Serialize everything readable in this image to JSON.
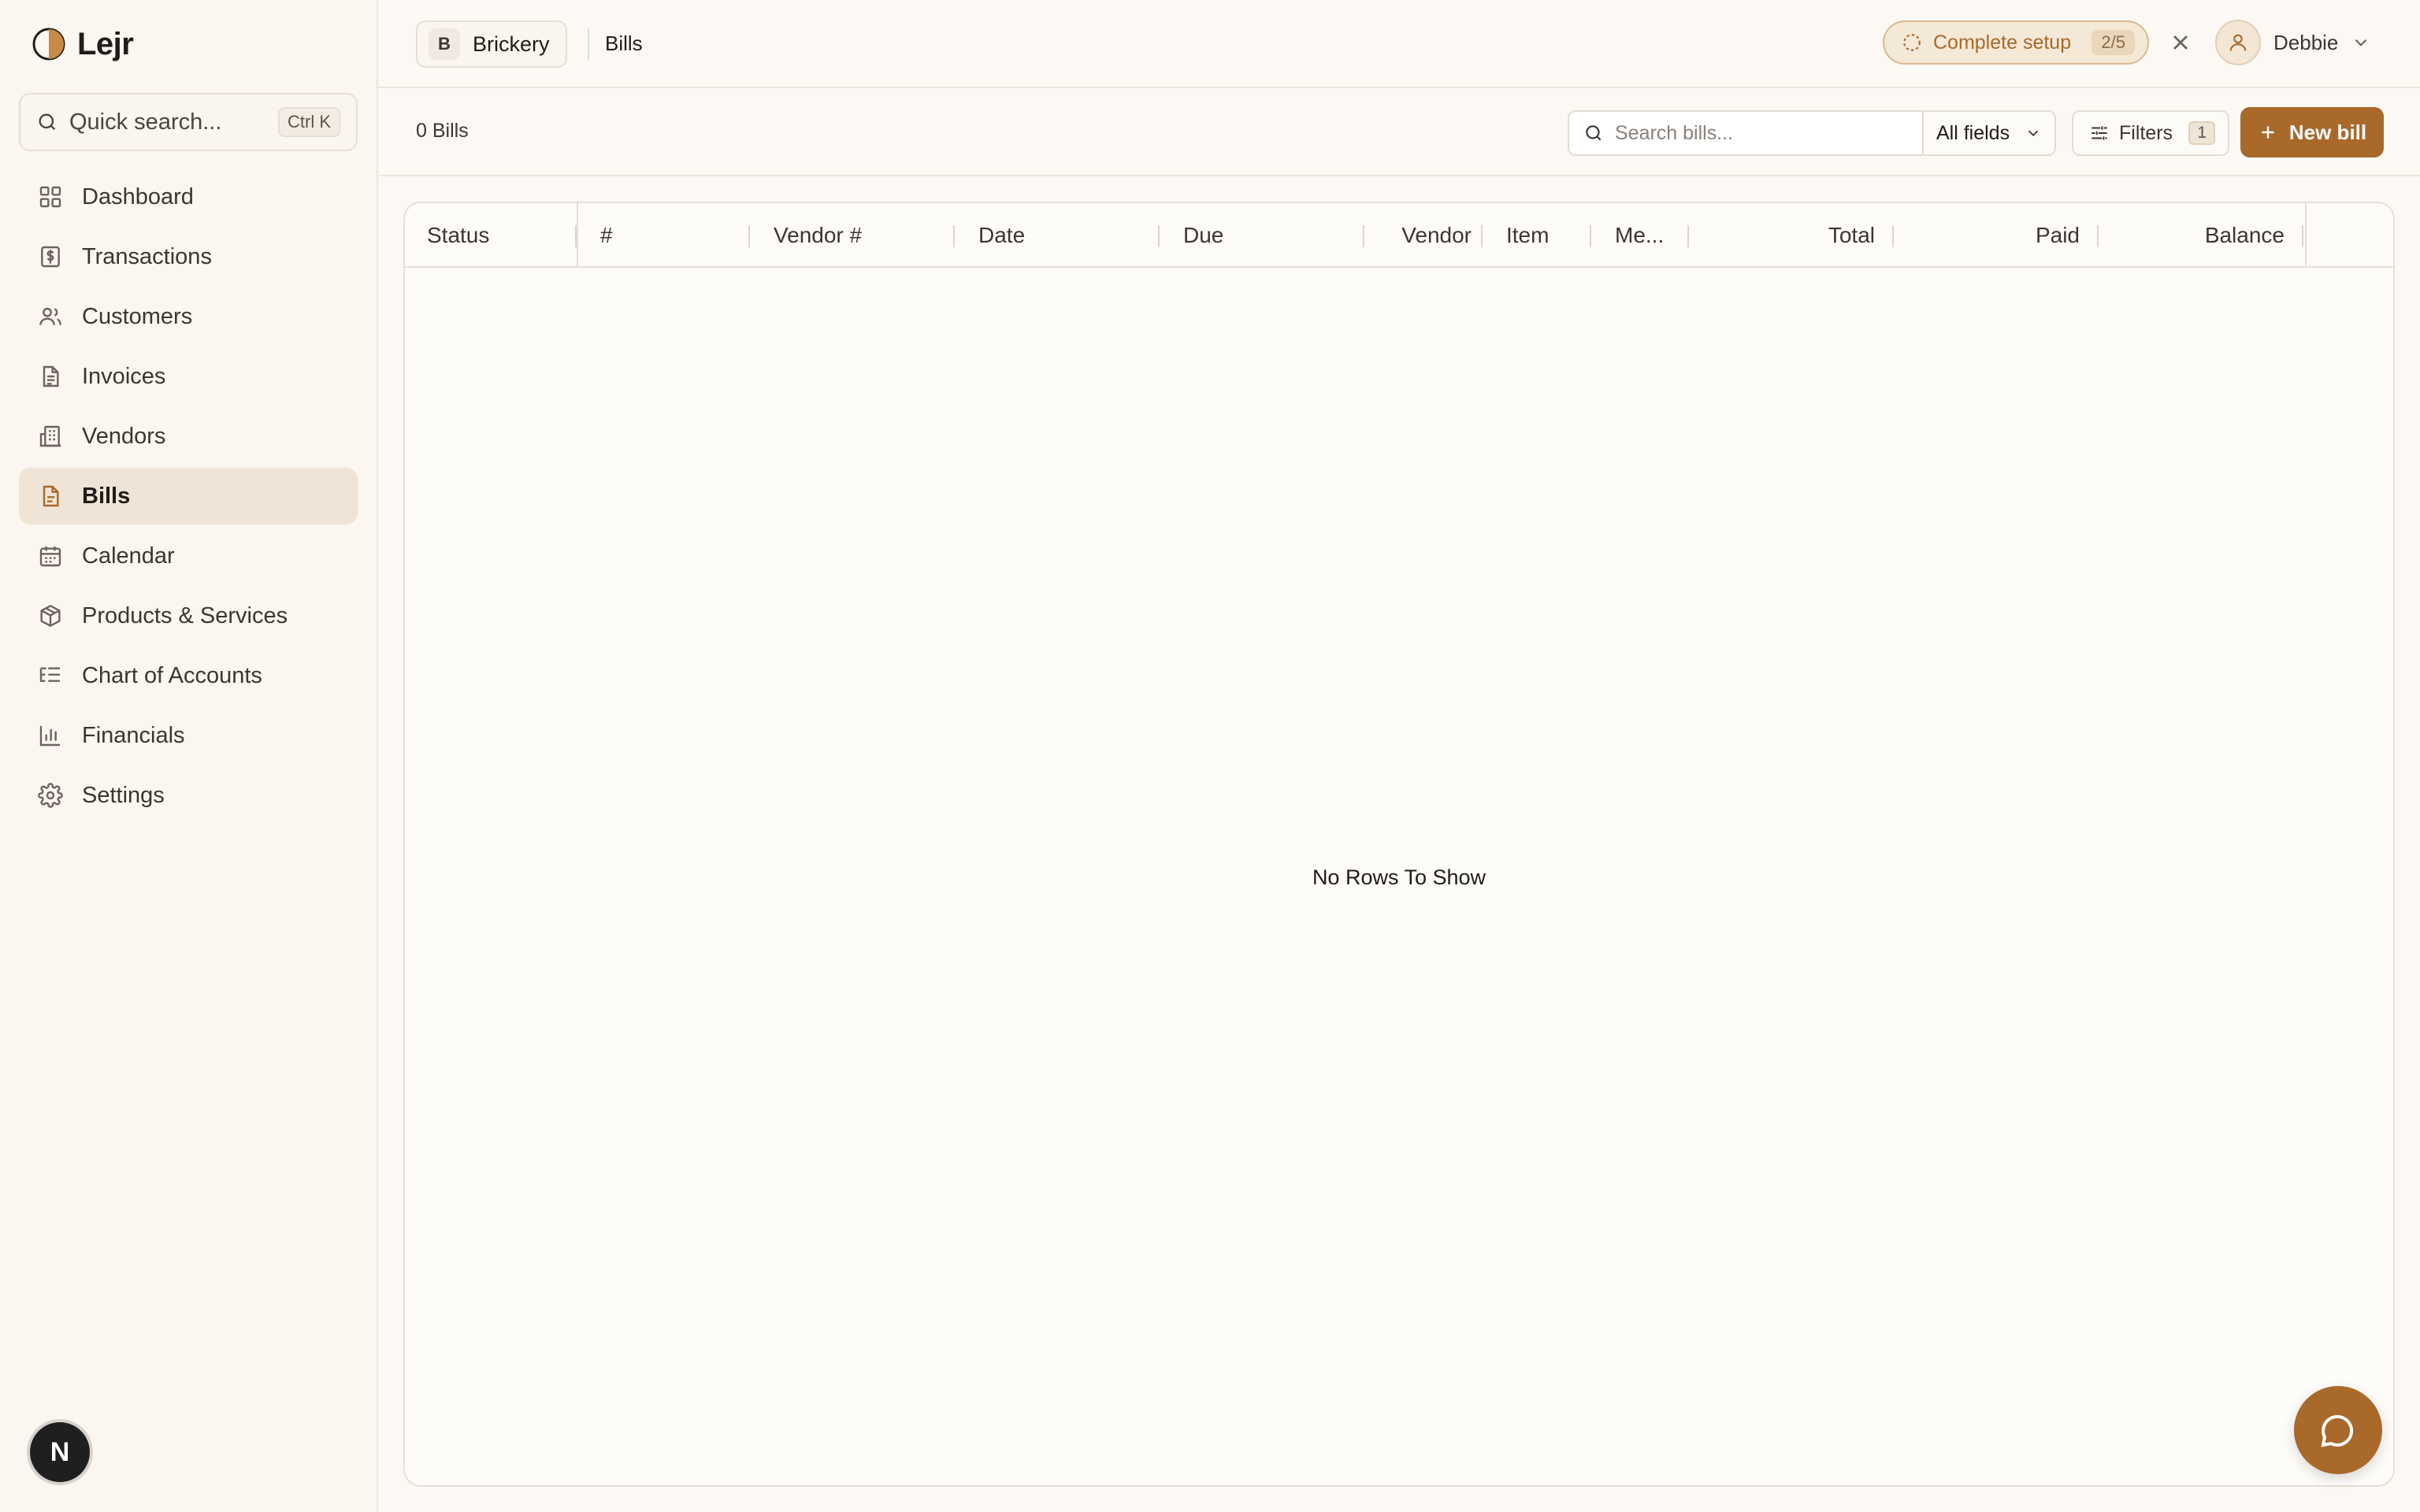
{
  "app": {
    "name": "Lejr"
  },
  "sidebar": {
    "search_placeholder": "Quick search...",
    "search_shortcut": "Ctrl K",
    "items": [
      {
        "label": "Dashboard",
        "icon": "grid-icon"
      },
      {
        "label": "Transactions",
        "icon": "dollar-receipt-icon"
      },
      {
        "label": "Customers",
        "icon": "users-icon"
      },
      {
        "label": "Invoices",
        "icon": "document-icon"
      },
      {
        "label": "Vendors",
        "icon": "building-icon"
      },
      {
        "label": "Bills",
        "icon": "bill-icon",
        "active": true
      },
      {
        "label": "Calendar",
        "icon": "calendar-icon"
      },
      {
        "label": "Products & Services",
        "icon": "package-icon"
      },
      {
        "label": "Chart of Accounts",
        "icon": "list-tree-icon"
      },
      {
        "label": "Financials",
        "icon": "bar-chart-icon"
      },
      {
        "label": "Settings",
        "icon": "gear-icon"
      }
    ],
    "footer_avatar": "N"
  },
  "header": {
    "workspace_initial": "B",
    "workspace_name": "Brickery",
    "breadcrumb": "Bills",
    "setup_label": "Complete setup",
    "setup_progress": "2/5",
    "user_name": "Debbie"
  },
  "toolbar": {
    "count_label": "0 Bills",
    "search_placeholder": "Search bills...",
    "field_select": "All fields",
    "filters_label": "Filters",
    "filters_count": "1",
    "new_bill_label": "New bill"
  },
  "table": {
    "columns": [
      "Status",
      "#",
      "Vendor #",
      "Date",
      "Due",
      "Vendor",
      "Item",
      "Me...",
      "Total",
      "Paid",
      "Balance"
    ],
    "empty_message": "No Rows To Show"
  },
  "colors": {
    "accent": "#a8692a",
    "active_nav_bg": "#efe4d6",
    "background": "#fcf9f5"
  }
}
